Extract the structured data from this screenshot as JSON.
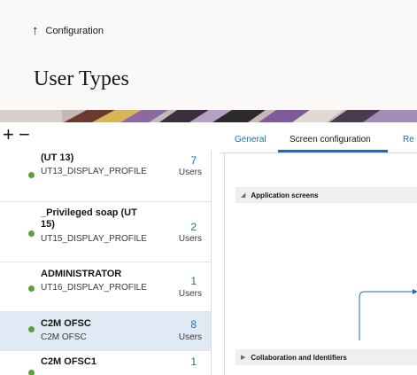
{
  "header": {
    "back_arrow": "↑",
    "back_label": "Configuration",
    "title": "User Types"
  },
  "toolbar": {
    "add_symbol": "+",
    "remove_symbol": "−"
  },
  "list": {
    "items": [
      {
        "name": "(UT 13)",
        "sub": "UT13_DISPLAY_PROFILE",
        "count": "7",
        "unit": "Users"
      },
      {
        "name": "_Privileged soap (UT 15)",
        "sub": "UT15_DISPLAY_PROFILE",
        "count": "2",
        "unit": "Users"
      },
      {
        "name": "ADMINISTRATOR",
        "sub": "UT16_DISPLAY_PROFILE",
        "count": "1",
        "unit": "Users"
      },
      {
        "name": "C2M OFSC",
        "sub": "C2M OFSC",
        "count": "8",
        "unit": "Users"
      },
      {
        "name": "C2M OFSC1",
        "sub": "",
        "count": "1",
        "unit": ""
      }
    ]
  },
  "tabs": {
    "general": "General",
    "screen_configuration": "Screen configuration",
    "partial": "Re"
  },
  "panel": {
    "section1": "Application screens",
    "section2": "Collaboration and Identifiers",
    "caret_open": "◢",
    "caret_closed": "▶"
  },
  "colors": {
    "accent": "#1e6bb8",
    "status_dot": "#5aa03c",
    "selected_row": "#dfeaf5"
  }
}
